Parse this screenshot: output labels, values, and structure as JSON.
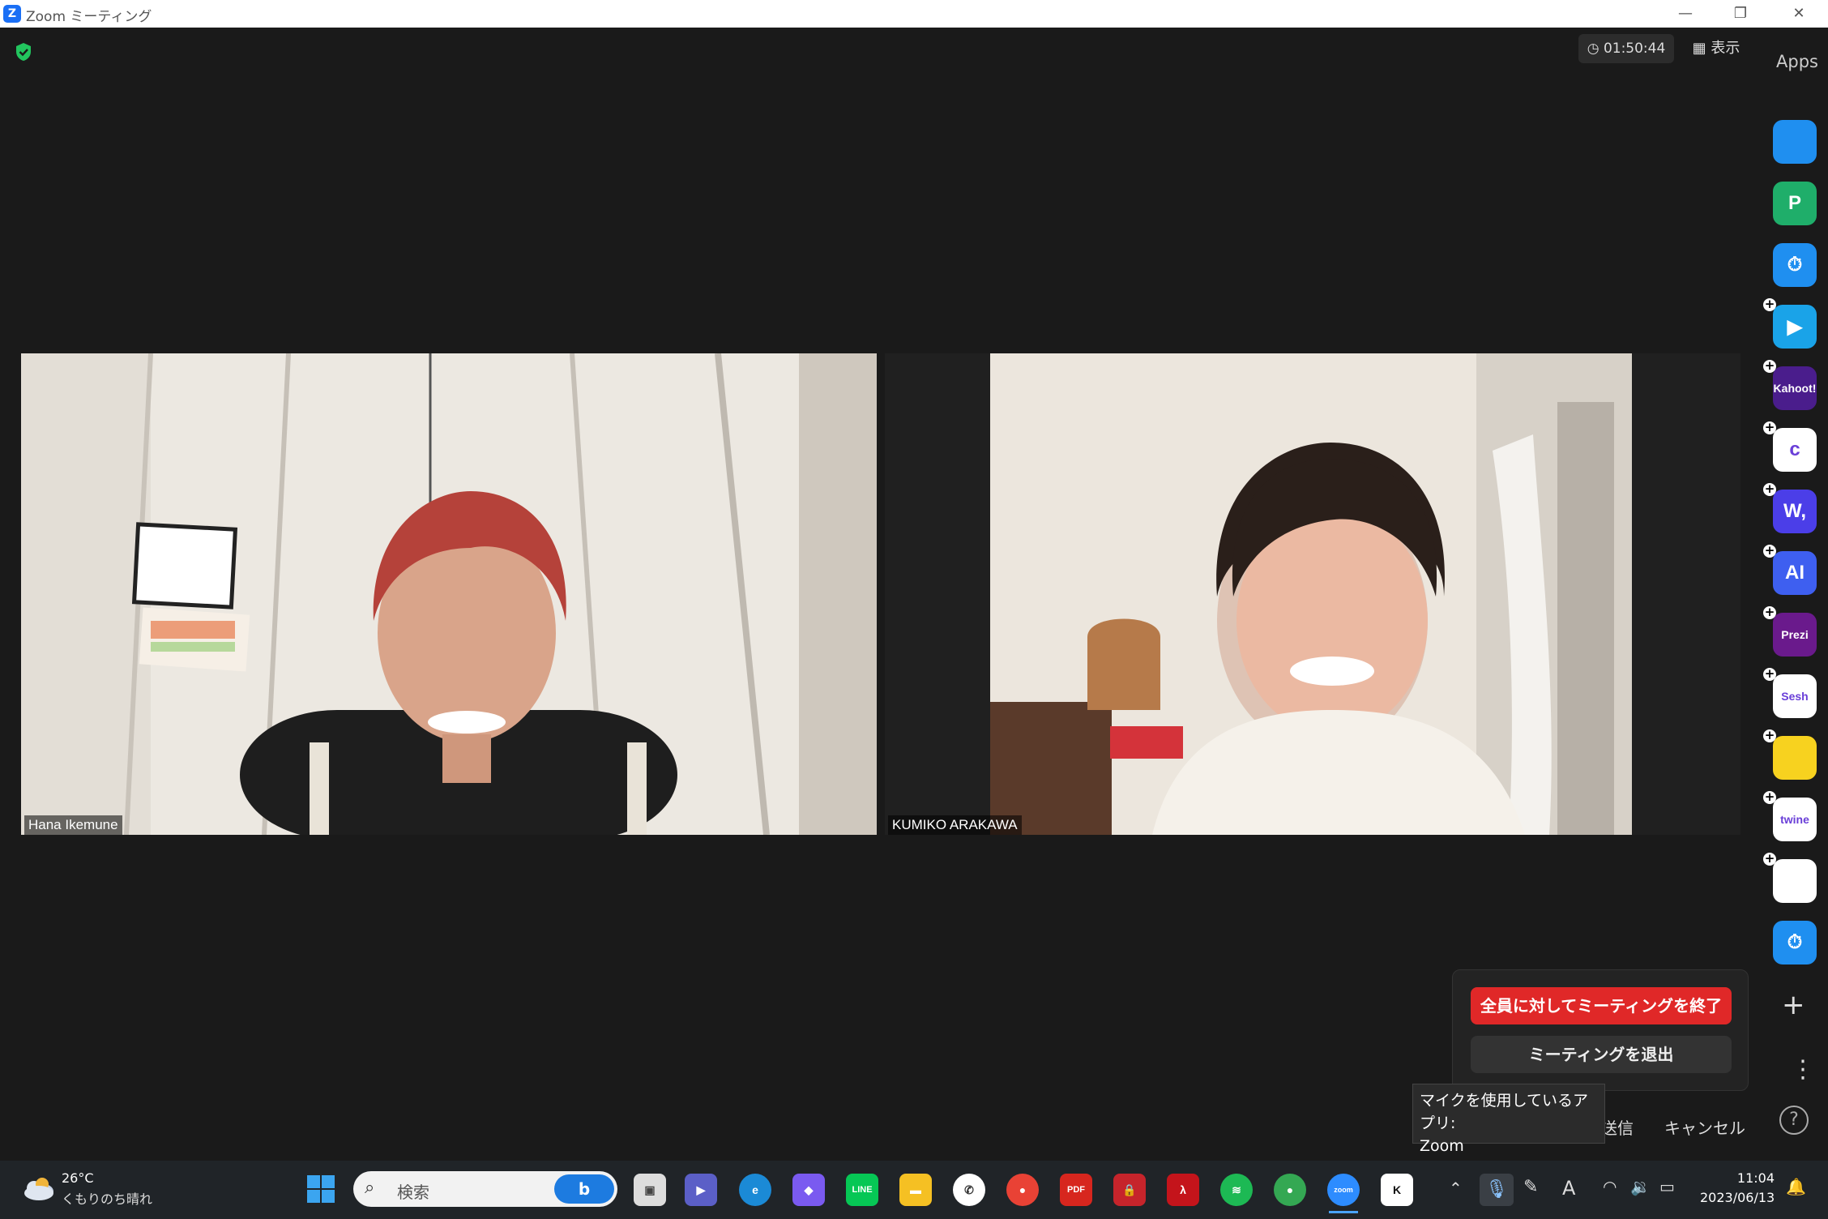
{
  "window": {
    "title": "Zoom ミーティング",
    "logo_letter": "Z",
    "controls": [
      "—",
      "❐",
      "✕"
    ]
  },
  "meeting": {
    "timer": "01:50:44",
    "view_label": "表示",
    "apps_title": "Apps"
  },
  "participants": [
    {
      "name": "Hana Ikemune"
    },
    {
      "name": "KUMIKO ARAKAWA"
    }
  ],
  "apps": [
    {
      "label": "",
      "icon": "smile-app-icon",
      "bg": "#1f8ff0"
    },
    {
      "label": "P",
      "icon": "p-app-icon",
      "bg": "#1fae6a"
    },
    {
      "label": "⏱",
      "icon": "timer-app-icon",
      "bg": "#1f8ff0"
    },
    {
      "label": "▶",
      "icon": "pitch-app-icon",
      "bg": "#1aa3e8"
    },
    {
      "label": "Kahoot!",
      "icon": "kahoot-app-icon",
      "bg": "#4a1d8c"
    },
    {
      "label": "c",
      "icon": "c-app-icon",
      "bg": "#ffffff"
    },
    {
      "label": "W,",
      "icon": "wooclap-app-icon",
      "bg": "#4b3ee8"
    },
    {
      "label": "AI",
      "icon": "ai-app-icon",
      "bg": "#3e5ff0"
    },
    {
      "label": "Prezi",
      "icon": "prezi-app-icon",
      "bg": "#6a1a8c"
    },
    {
      "label": "Sesh",
      "icon": "sesh-app-icon",
      "bg": "#ffffff"
    },
    {
      "label": "",
      "icon": "emoji-app-icon",
      "bg": "#f7d21f"
    },
    {
      "label": "twine",
      "icon": "twine-app-icon",
      "bg": "#ffffff"
    },
    {
      "label": "",
      "icon": "blocks-app-icon",
      "bg": "#ffffff"
    },
    {
      "label": "⏱",
      "icon": "stopwatch-app-icon",
      "bg": "#1f8ff0"
    }
  ],
  "end_menu": {
    "end_all": "全員に対してミーティングを終了",
    "leave": "ミーティングを退出",
    "cancel": "キャンセル",
    "partial": "送信"
  },
  "tooltip": {
    "line1": "マイクを使用しているアプリ:",
    "line2": "Zoom"
  },
  "taskbar": {
    "weather_temp": "26°C",
    "weather_desc": "くもりのち晴れ",
    "search_placeholder": "検索",
    "time": "11:04",
    "date": "2023/06/13"
  }
}
